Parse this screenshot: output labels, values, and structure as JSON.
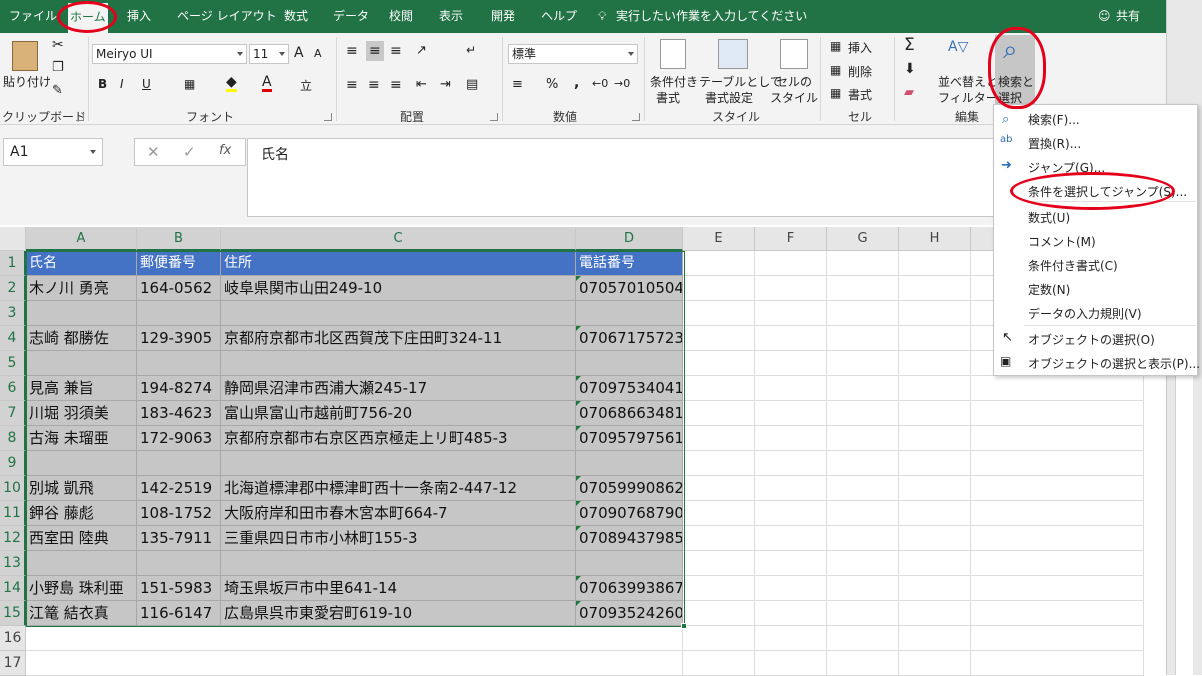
{
  "tabs": [
    "ファイル",
    "ホーム",
    "挿入",
    "ページ レイアウト",
    "数式",
    "データ",
    "校閲",
    "表示",
    "開発",
    "ヘルプ"
  ],
  "tell_me": "実行したい作業を入力してください",
  "share": "共有",
  "ribbon": {
    "clipboard": {
      "paste": "貼り付け",
      "label": "クリップボード"
    },
    "font": {
      "name": "Meiryo UI",
      "size": "11",
      "grow": "A",
      "shrink": "A",
      "bold": "B",
      "italic": "I",
      "underline": "U",
      "label": "フォント"
    },
    "alignment": {
      "label": "配置"
    },
    "number": {
      "format": "標準",
      "percent": "%",
      "comma": ",",
      "label": "数値"
    },
    "styles": {
      "conditional": [
        "条件付き",
        "書式"
      ],
      "table": [
        "テーブルとして",
        "書式設定"
      ],
      "cell": [
        "セルの",
        "スタイル"
      ],
      "label": "スタイル"
    },
    "cells": {
      "insert": "挿入",
      "delete": "削除",
      "format": "書式",
      "label": "セル"
    },
    "editing": {
      "sort": [
        "並べ替えと",
        "フィルター"
      ],
      "find": [
        "検索と",
        "選択"
      ],
      "label": "編集"
    }
  },
  "formula": {
    "namebox": "A1",
    "fx": "fx",
    "content": "氏名"
  },
  "columns": [
    "A",
    "B",
    "C",
    "D",
    "E",
    "F",
    "G",
    "H"
  ],
  "rows": [
    "1",
    "2",
    "3",
    "4",
    "5",
    "6",
    "7",
    "8",
    "9",
    "10",
    "11",
    "12",
    "13",
    "14",
    "15",
    "16",
    "17"
  ],
  "table": {
    "header": [
      "氏名",
      "郵便番号",
      "住所",
      "電話番号"
    ],
    "rows": [
      [
        "木ノ川 勇亮",
        "164-0562",
        "岐阜県関市山田249-10",
        "07057010504"
      ],
      [
        "",
        "",
        "",
        ""
      ],
      [
        "志崎 都勝佐",
        "129-3905",
        "京都府京都市北区西賀茂下庄田町324-11",
        "07067175723"
      ],
      [
        "",
        "",
        "",
        ""
      ],
      [
        "見高 兼旨",
        "194-8274",
        "静岡県沼津市西浦大瀬245-17",
        "07097534041"
      ],
      [
        "川堀 羽須美",
        "183-4623",
        "富山県富山市越前町756-20",
        "07068663481"
      ],
      [
        "古海 未瑠亜",
        "172-9063",
        "京都府京都市右京区西京極走上リ町485-3",
        "07095797561"
      ],
      [
        "",
        "",
        "",
        ""
      ],
      [
        "別城 凱飛",
        "142-2519",
        "北海道標津郡中標津町西十一条南2-447-12",
        "07059990862"
      ],
      [
        "鉀谷 藤彪",
        "108-1752",
        "大阪府岸和田市春木宮本町664-7",
        "07090768790"
      ],
      [
        "西室田 陸典",
        "135-7911",
        "三重県四日市市小林町155-3",
        "07089437985"
      ],
      [
        "",
        "",
        "",
        ""
      ],
      [
        "小野島 珠利亜",
        "151-5983",
        "埼玉県坂戸市中里641-14",
        "07063993867"
      ],
      [
        "江篭 結衣真",
        "116-6147",
        "広島県呉市東愛宕町619-10",
        "07093524260"
      ]
    ]
  },
  "menu": {
    "items": [
      "検索(F)...",
      "置換(R)...",
      "ジャンプ(G)...",
      "条件を選択してジャンプ(S)...",
      "数式(U)",
      "コメント(M)",
      "条件付き書式(C)",
      "定数(N)",
      "データの入力規則(V)",
      "オブジェクトの選択(O)",
      "オブジェクトの選択と表示(P)..."
    ]
  },
  "colors": {
    "excel_green": "#217346",
    "header_blue": "#4472c4",
    "annotation_red": "#e4001b"
  }
}
